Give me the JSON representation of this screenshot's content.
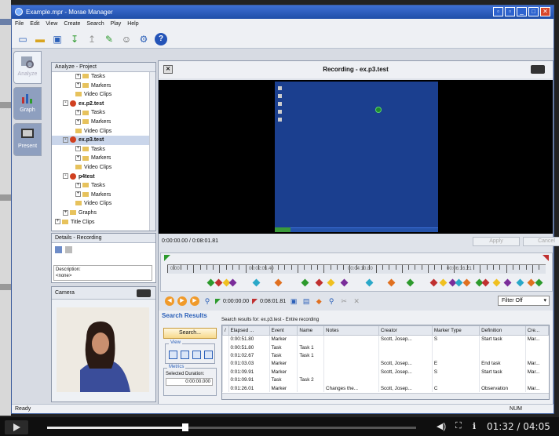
{
  "window": {
    "title": "Example.mpr - Morae Manager"
  },
  "menu": [
    "File",
    "Edit",
    "View",
    "Create",
    "Search",
    "Play",
    "Help"
  ],
  "toolbar": {
    "icons": [
      "new-icon",
      "open-icon",
      "save-icon",
      "import-icon",
      "export-icon",
      "clip-icon",
      "participant-icon",
      "properties-icon",
      "help-icon"
    ],
    "help_glyph": "?"
  },
  "side_tabs": [
    {
      "label": "Analyze",
      "icon": "analyze-icon",
      "active": true
    },
    {
      "label": "Graph",
      "icon": "graph-icon",
      "active": false
    },
    {
      "label": "Present",
      "icon": "present-icon",
      "active": false
    }
  ],
  "tree": {
    "header": "Analyze - Project",
    "rows": [
      {
        "label": "Tasks",
        "level": 2,
        "kind": "folder",
        "expander": "+"
      },
      {
        "label": "Markers",
        "level": 2,
        "kind": "folder",
        "expander": "+"
      },
      {
        "label": "Video Clips",
        "level": 2,
        "kind": "folder",
        "expander": ""
      },
      {
        "label": "ex.p2.test",
        "level": 1,
        "kind": "recording",
        "expander": "-",
        "bold": true
      },
      {
        "label": "Tasks",
        "level": 2,
        "kind": "folder",
        "expander": "+"
      },
      {
        "label": "Markers",
        "level": 2,
        "kind": "folder",
        "expander": "+"
      },
      {
        "label": "Video Clips",
        "level": 2,
        "kind": "folder",
        "expander": ""
      },
      {
        "label": "ex.p3.test",
        "level": 1,
        "kind": "recording",
        "expander": "-",
        "bold": true,
        "selected": true
      },
      {
        "label": "Tasks",
        "level": 2,
        "kind": "folder",
        "expander": "+"
      },
      {
        "label": "Markers",
        "level": 2,
        "kind": "folder",
        "expander": "+"
      },
      {
        "label": "Video Clips",
        "level": 2,
        "kind": "folder",
        "expander": ""
      },
      {
        "label": "p4test",
        "level": 1,
        "kind": "recording",
        "expander": "-",
        "bold": true
      },
      {
        "label": "Tasks",
        "level": 2,
        "kind": "folder",
        "expander": "+"
      },
      {
        "label": "Markers",
        "level": 2,
        "kind": "folder",
        "expander": "+"
      },
      {
        "label": "Video Clips",
        "level": 2,
        "kind": "folder",
        "expander": ""
      },
      {
        "label": "Graphs",
        "level": 1,
        "kind": "folder",
        "expander": "+"
      },
      {
        "label": "Title Clips",
        "level": 0,
        "kind": "folder",
        "expander": "+"
      }
    ]
  },
  "details": {
    "header": "Details - Recording",
    "description_label": "Description:",
    "description_value": "<none>"
  },
  "camera": {
    "header": "Camera"
  },
  "recording": {
    "title": "Recording - ex.p3.test",
    "time_position": "0:00:00.00 / 0:08:01.81",
    "apply_label": "Apply",
    "cancel_label": "Cancel",
    "ruler_labels": [
      "0:00",
      "00:02:05.40",
      "00:04:10.80",
      "00:06:16.21"
    ],
    "start_time": "0:00:00.00",
    "end_time": "0:08:01.81",
    "filter": "Filter Off",
    "marker_colors": [
      "#2d9a2d",
      "#c03030",
      "#f0c020",
      "#7a2d9a",
      "#2aa8c8",
      "#e07020"
    ]
  },
  "search": {
    "title": "Search Results",
    "results_for": "Search results for: ex.p3.test - Entire recording",
    "search_button": "Search...",
    "view_label": "View",
    "metrics_label": "Metrics",
    "selected_duration_label": "Selected Duration:",
    "selected_duration_value": "0:00:00.000",
    "columns": [
      "/",
      "Elapsed ...",
      "Event",
      "Name",
      "Notes",
      "Creator",
      "Marker Type",
      "Definition",
      "Cre..."
    ],
    "rows": [
      [
        "",
        "0:00:51.80",
        "Marker",
        "",
        "",
        "Scott, Josep...",
        "S",
        "Start task",
        "Mar..."
      ],
      [
        "",
        "0:00:51.80",
        "Task",
        "Task 1",
        "",
        "",
        "",
        "",
        ""
      ],
      [
        "",
        "0:01:02.67",
        "Task",
        "Task 1",
        "",
        "",
        "",
        "",
        ""
      ],
      [
        "",
        "0:01:03.03",
        "Marker",
        "",
        "",
        "Scott, Josep...",
        "E",
        "End task",
        "Mar..."
      ],
      [
        "",
        "0:01:09.91",
        "Marker",
        "",
        "",
        "Scott, Josep...",
        "S",
        "Start task",
        "Mar..."
      ],
      [
        "",
        "0:01:09.91",
        "Task",
        "Task 2",
        "",
        "",
        "",
        "",
        ""
      ],
      [
        "",
        "0:01:26.01",
        "Marker",
        "",
        "Changes the...",
        "Scott, Josep...",
        "C",
        "Observation",
        "Mar..."
      ]
    ]
  },
  "status": {
    "left": "Ready",
    "right": "NUM"
  },
  "player": {
    "time": "01:32 / 04:05",
    "progress": 0.375,
    "icons": [
      "volume-icon",
      "fullscreen-icon",
      "info-icon"
    ]
  }
}
